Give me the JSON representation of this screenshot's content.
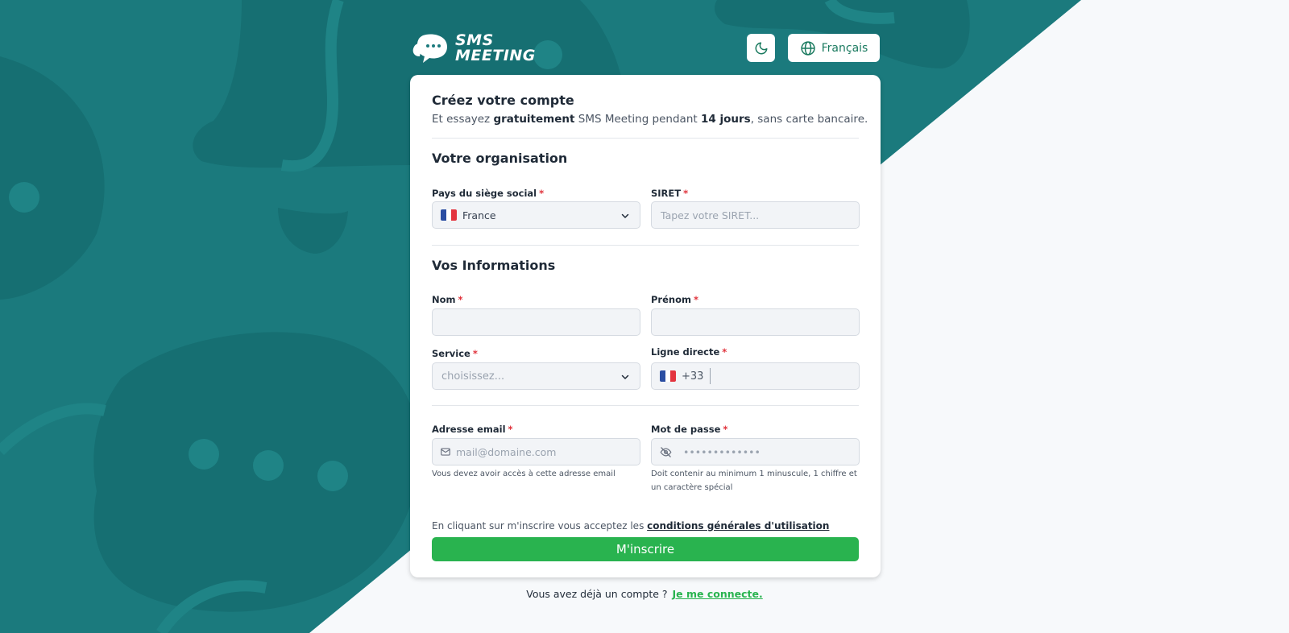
{
  "brand": {
    "line1": "SMS",
    "line2": "MEETING"
  },
  "header": {
    "language_label": "Français"
  },
  "colors": {
    "teal": "#1b7a7d",
    "green": "#29b34f",
    "required": "#e0323b"
  },
  "form": {
    "title": "Créez votre compte",
    "subtitle": {
      "part1": "Et essayez ",
      "bold1": "gratuitement",
      "part2": " SMS Meeting pendant ",
      "bold2": "14 jours",
      "part3": ", sans carte bancaire."
    },
    "required_mark": "*",
    "organisation": {
      "section_title": "Votre organisation",
      "country_label": "Pays du siège social",
      "country_value": "France",
      "siret_label": "SIRET",
      "siret_placeholder": "Tapez votre SIRET..."
    },
    "info": {
      "section_title": "Vos Informations",
      "nom_label": "Nom",
      "prenom_label": "Prénom",
      "service_label": "Service",
      "service_placeholder": "choisissez...",
      "phone_label": "Ligne directe",
      "phone_prefix": "+33"
    },
    "account": {
      "email_label": "Adresse email",
      "email_placeholder": "mail@domaine.com",
      "email_hint": "Vous devez avoir accès à cette adresse email",
      "password_label": "Mot de passe",
      "password_placeholder": "•••••••••••••",
      "password_hint_line1": "Doit contenir au minimum 1 minuscule, 1 chiffre et",
      "password_hint_line2": "un caractère spécial"
    },
    "terms_text": "En cliquant sur m'inscrire vous acceptez les ",
    "terms_link": "conditions générales d'utilisation",
    "submit_label": "M'inscrire"
  },
  "footer": {
    "text": "Vous avez déjà un compte ? ",
    "link": "Je me connecte."
  }
}
